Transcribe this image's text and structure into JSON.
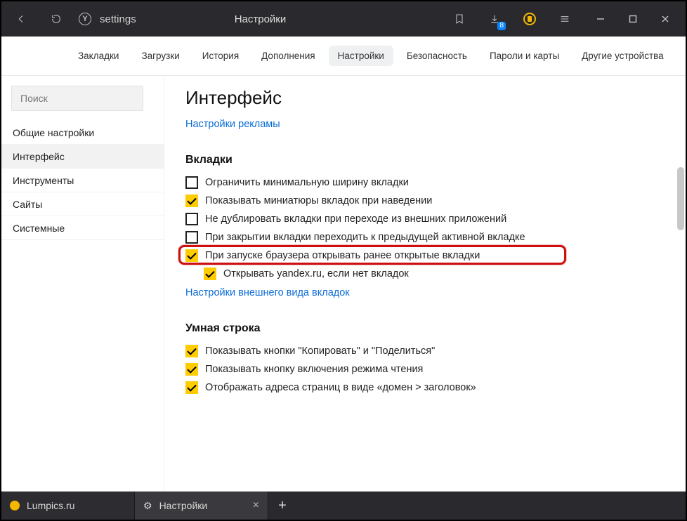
{
  "titlebar": {
    "address": "settings",
    "page_title": "Настройки",
    "download_badge": "8"
  },
  "toptabs": [
    "Закладки",
    "Загрузки",
    "История",
    "Дополнения",
    "Настройки",
    "Безопасность",
    "Пароли и карты",
    "Другие устройства"
  ],
  "toptabs_active_index": 4,
  "sidebar": {
    "search_placeholder": "Поиск",
    "items": [
      "Общие настройки",
      "Интерфейс",
      "Инструменты",
      "Сайты",
      "Системные"
    ],
    "active_index": 1
  },
  "main": {
    "heading": "Интерфейс",
    "ads_link": "Настройки рекламы",
    "tabs_section": {
      "title": "Вкладки",
      "options": [
        {
          "label": "Ограничить минимальную ширину вкладки",
          "checked": false,
          "indent": false,
          "highlight": false
        },
        {
          "label": "Показывать миниатюры вкладок при наведении",
          "checked": true,
          "indent": false,
          "highlight": false
        },
        {
          "label": "Не дублировать вкладки при переходе из внешних приложений",
          "checked": false,
          "indent": false,
          "highlight": false
        },
        {
          "label": "При закрытии вкладки переходить к предыдущей активной вкладке",
          "checked": false,
          "indent": false,
          "highlight": false
        },
        {
          "label": "При запуске браузера открывать ранее открытые вкладки",
          "checked": true,
          "indent": false,
          "highlight": true
        },
        {
          "label": "Открывать yandex.ru, если нет вкладок",
          "checked": true,
          "indent": true,
          "highlight": false
        }
      ],
      "appearance_link": "Настройки внешнего вида вкладок"
    },
    "smartline_section": {
      "title": "Умная строка",
      "options": [
        {
          "label": "Показывать кнопки \"Копировать\" и \"Поделиться\"",
          "checked": true
        },
        {
          "label": "Показывать кнопку включения режима чтения",
          "checked": true
        },
        {
          "label": "Отображать адреса страниц в виде «домен > заголовок»",
          "checked": true
        }
      ]
    }
  },
  "tabstrip": {
    "tabs": [
      {
        "label": "Lumpics.ru",
        "icon": "fav",
        "closeable": false,
        "active": false
      },
      {
        "label": "Настройки",
        "icon": "gear",
        "closeable": true,
        "active": true
      }
    ]
  }
}
